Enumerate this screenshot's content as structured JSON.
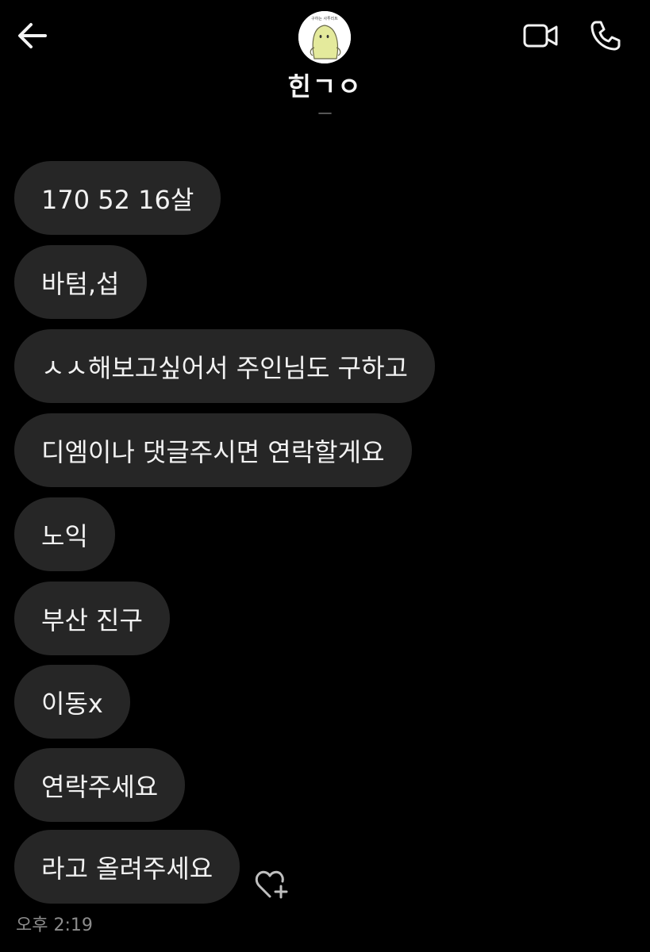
{
  "header": {
    "back_icon": "arrow-left-icon",
    "avatar_badge_text": "구하는 사투리트",
    "contact_name": "힌ㄱㅇ",
    "contact_sub": "—",
    "video_icon": "video-camera-icon",
    "call_icon": "phone-icon"
  },
  "messages": [
    {
      "text": "170 52 16살"
    },
    {
      "text": "바텀,섭"
    },
    {
      "text": "ㅅㅅ해보고싶어서 주인님도 구하고"
    },
    {
      "text": "디엠이나 댓글주시면 연락할게요"
    },
    {
      "text": "노익"
    },
    {
      "text": "부산 진구"
    },
    {
      "text": "이동x"
    },
    {
      "text": "연락주세요"
    },
    {
      "text": "라고 올려주세요"
    }
  ],
  "reaction_icon": "heart-plus-icon",
  "timestamp": "오후 2:19",
  "colors": {
    "background": "#000000",
    "bubble": "#262626",
    "text": "#f2f2f2",
    "muted": "#8c8c8c"
  }
}
